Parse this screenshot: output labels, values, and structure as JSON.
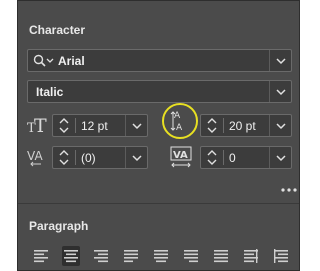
{
  "character": {
    "title": "Character",
    "font_family": "Arial",
    "font_style": "Italic",
    "font_size": "12 pt",
    "leading": "20 pt",
    "kerning": "(0)",
    "tracking": "0"
  },
  "paragraph": {
    "title": "Paragraph",
    "alignments": [
      "align-left",
      "align-center",
      "align-right",
      "justify-left",
      "justify-center",
      "justify-right",
      "justify-all",
      "align-toward-spine",
      "align-away-spine"
    ],
    "active_alignment": "align-center"
  },
  "colors": {
    "panel_bg": "#4b4b4b",
    "field_bg": "#3c3c3c",
    "highlight_circle": "#e8e022"
  }
}
